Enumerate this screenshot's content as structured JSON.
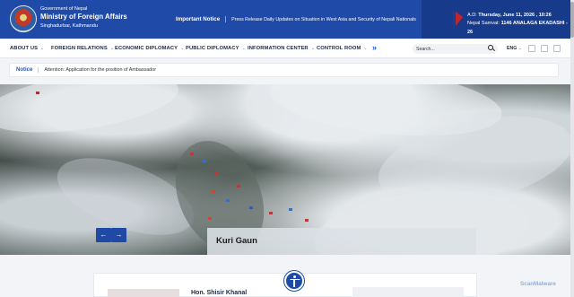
{
  "header": {
    "government": "Government of Nepal",
    "ministry": "Ministry of Foreign Affairs",
    "location": "Singhadurbar, Kathmandu",
    "important_notice_label": "Important Notice",
    "important_notice_text": "Press Release Daily Updates on Situation in West Asia and Security of Nepali Nationals",
    "ad_date_prefix": "A.D:",
    "ad_date": "Thursday, June 11, 2026 , 10:26",
    "nepal_samvat_prefix": "Nepal Samvat:",
    "nepal_samvat": "1146 ANALAGA EKADASHI - 26"
  },
  "nav": {
    "items": [
      {
        "label": "ABOUT US"
      },
      {
        "label": "FOREIGN RELATIONS"
      },
      {
        "label": "ECONOMIC DIPLOMACY"
      },
      {
        "label": "PUBLIC DIPLOMACY"
      },
      {
        "label": "INFORMATION CENTER"
      },
      {
        "label": "CONTROL ROOM"
      }
    ],
    "more": "»",
    "search_placeholder": "Search...",
    "language": "ENG"
  },
  "notice": {
    "label": "Notice",
    "text": "Attention: Application for the position of Ambassador"
  },
  "hero": {
    "caption": "Kuri Gaun",
    "prev": "←",
    "next": "→"
  },
  "content": {
    "minister_name": "Hon. Shisir Khanal"
  },
  "watermark": "ScanMalware",
  "colors": {
    "primary": "#1f4aa8",
    "primary_dark": "#173a8a",
    "accent": "#2457b8"
  }
}
